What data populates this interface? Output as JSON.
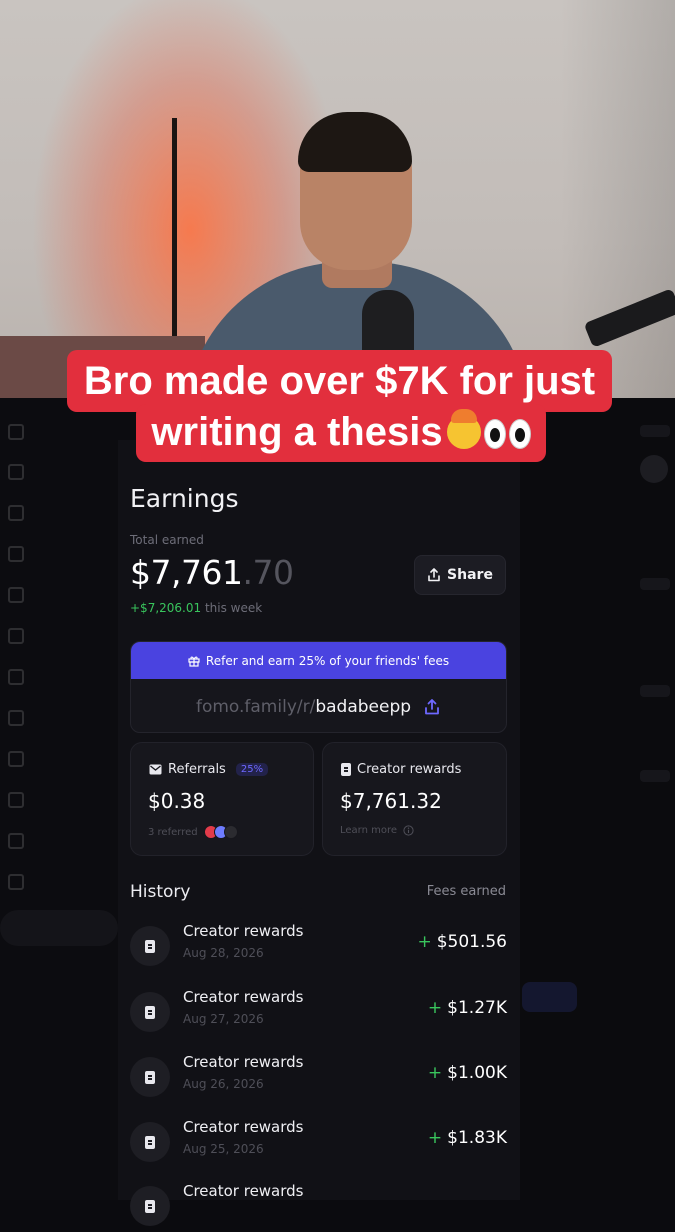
{
  "caption": {
    "line1": "Bro made over $7K for just",
    "line2": "writing a thesis",
    "emojis": [
      "exploding-head-emoji",
      "eyes-emoji"
    ]
  },
  "earnings": {
    "title": "Earnings",
    "total_label": "Total earned",
    "total_dollars": "$7,761",
    "total_cents": ".70",
    "week_gain": "+$7,206.01",
    "week_label": " this week",
    "share_label": "Share"
  },
  "referral": {
    "banner": "Refer and earn 25% of your friends' fees",
    "link_prefix": "fomo.family/r/",
    "link_code": "badabeepp"
  },
  "cards": {
    "referrals": {
      "title": "Referrals",
      "badge": "25%",
      "value": "$0.38",
      "sub": "3 referred"
    },
    "creator_rewards": {
      "title": "Creator rewards",
      "value": "$7,761.32",
      "sub": "Learn more"
    }
  },
  "history": {
    "title": "History",
    "column": "Fees earned",
    "rows": [
      {
        "title": "Creator rewards",
        "date": "Aug 28, 2026",
        "amount": "$501.56"
      },
      {
        "title": "Creator rewards",
        "date": "Aug 27, 2026",
        "amount": "$1.27K"
      },
      {
        "title": "Creator rewards",
        "date": "Aug 26, 2026",
        "amount": "$1.00K"
      },
      {
        "title": "Creator rewards",
        "date": "Aug 25, 2026",
        "amount": "$1.83K"
      },
      {
        "title": "Creator rewards",
        "date": "",
        "amount": ""
      }
    ]
  },
  "colors": {
    "accent": "#4a43e0",
    "gain": "#39c55d",
    "caption_bg": "#e22f3d"
  }
}
